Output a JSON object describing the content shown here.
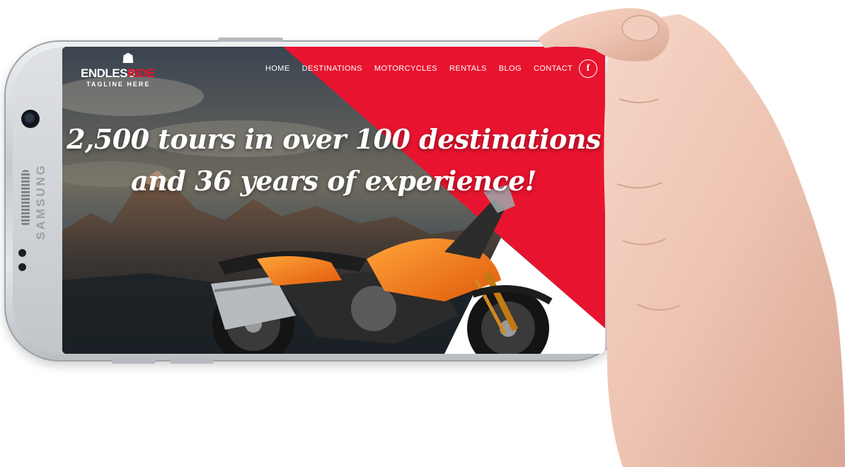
{
  "device": {
    "brand_text": "SAMSUNG"
  },
  "website": {
    "logo": {
      "word_white": "ENDLESS",
      "word_red": "RIDE",
      "tagline": "TAGLINE HERE"
    },
    "nav": {
      "items": [
        "HOME",
        "DESTINATIONS",
        "MOTORCYCLES",
        "RENTALS",
        "BLOG",
        "CONTACT"
      ]
    },
    "social": {
      "facebook_label": "f",
      "icon": "facebook-icon"
    },
    "hero": {
      "headline_line1": "2,500 tours in over 100 destinations",
      "headline_line2": "and 36 years of experience!"
    },
    "colors": {
      "accent_red": "#e8142f",
      "bike_orange": "#f07a12",
      "sky_dark": "#2b3440"
    }
  }
}
